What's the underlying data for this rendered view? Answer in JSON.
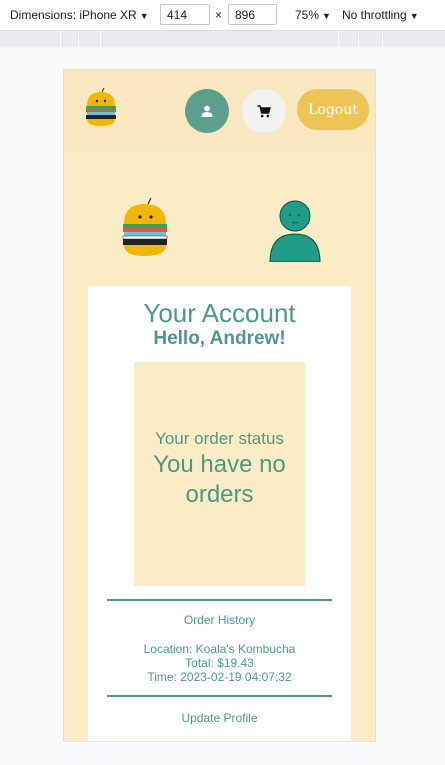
{
  "devtools": {
    "device_label": "Dimensions: iPhone XR",
    "width_value": "414",
    "times": "×",
    "height_value": "896",
    "zoom_label": "75%",
    "throttle_label": "No throttling"
  },
  "nav": {
    "logo_icon": "burger-logo-icon",
    "user_icon": "user-icon",
    "cart_icon": "cart-icon",
    "logout_label": "Logout"
  },
  "account": {
    "title": "Your Account",
    "greeting": "Hello, Andrew!",
    "status_label": "Your order status",
    "status_value": "You have no orders",
    "order_history_label": "Order History",
    "order": {
      "location": "Location: Koala's Kombucha",
      "total": "Total: $19.43",
      "time": "Time: 2023-02-19 04:07:32"
    },
    "update_profile_label": "Update Profile"
  },
  "colors": {
    "page_bg": "#fbecc6",
    "teal": "#4b9a84",
    "logout_yellow": "#ecc556"
  }
}
